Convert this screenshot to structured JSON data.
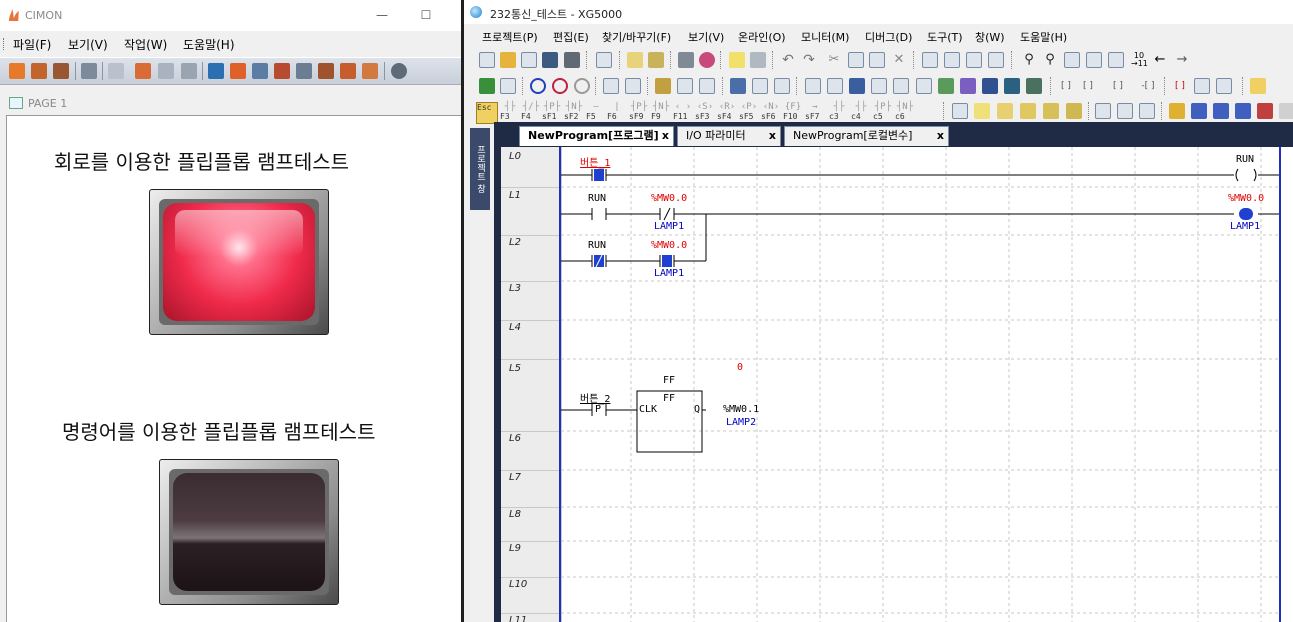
{
  "cimon": {
    "title": "CIMON",
    "menu": [
      "파일(F)",
      "보기(V)",
      "작업(W)",
      "도움말(H)"
    ],
    "page_tab": "PAGE 1",
    "lamp1_title": "회로를 이용한 플립플롭 램프테스트",
    "lamp2_title": "명령어를 이용한 플립플롭 램프테스트",
    "lamp1_state": "on",
    "lamp2_state": "off"
  },
  "xg": {
    "title": "232통신_테스트 - XG5000",
    "menu": [
      "프로젝트(P)",
      "편집(E)",
      "찾기/바꾸기(F)",
      "보기(V)",
      "온라인(O)",
      "모니터(M)",
      "디버그(D)",
      "도구(T)",
      "창(W)",
      "도움말(H)"
    ],
    "fkeys": [
      {
        "sym": "",
        "lbl": "Esc"
      },
      {
        "sym": "┤├",
        "lbl": "F3"
      },
      {
        "sym": "┤/├",
        "lbl": "F4"
      },
      {
        "sym": "┤P├",
        "lbl": "sF1"
      },
      {
        "sym": "┤N├",
        "lbl": "sF2"
      },
      {
        "sym": "—",
        "lbl": "F5"
      },
      {
        "sym": "|",
        "lbl": "F6"
      },
      {
        "sym": "┤P├",
        "lbl": "sF9"
      },
      {
        "sym": "┤N├",
        "lbl": "F9"
      },
      {
        "sym": "‹ ›",
        "lbl": "F11"
      },
      {
        "sym": "‹S›",
        "lbl": "sF3"
      },
      {
        "sym": "‹R›",
        "lbl": "sF4"
      },
      {
        "sym": "‹P›",
        "lbl": "sF5"
      },
      {
        "sym": "‹N›",
        "lbl": "sF6"
      },
      {
        "sym": "{F}",
        "lbl": "F10"
      },
      {
        "sym": "→",
        "lbl": "sF7"
      },
      {
        "sym": "┤├",
        "lbl": "c3"
      },
      {
        "sym": "┤├",
        "lbl": "c4"
      },
      {
        "sym": "┤P├",
        "lbl": "c5"
      },
      {
        "sym": "┤N├",
        "lbl": "c6"
      }
    ],
    "side_tab": "프로젝트 창",
    "tabs": [
      "NewProgram[프로그램]",
      "I/O 파라미터",
      "NewProgram[로컬변수]"
    ],
    "tab_close": "x",
    "rungs": [
      "L0",
      "L1",
      "L2",
      "L3",
      "L4",
      "L5",
      "L6",
      "L7",
      "L8",
      "L9",
      "L10",
      "L11"
    ],
    "ladder": {
      "l0_contact_name": "버튼_1",
      "l0_coil_name": "RUN",
      "l1_contact_name": "RUN",
      "l1_nc_name": "%MW0.0",
      "l1_nc_comment": "LAMP1",
      "l1_coil_name": "%MW0.0",
      "l1_coil_comment": "LAMP1",
      "l2_nc_name": "RUN",
      "l2_no_name": "%MW0.0",
      "l2_no_comment": "LAMP1",
      "l5_value": "0",
      "l5_contact_name": "버튼_2",
      "l5_contact_type": "P",
      "ff_title": "FF",
      "ff_inner": "FF",
      "ff_clk": "CLK",
      "ff_q": "Q",
      "ff_out_name": "%MW0.1",
      "ff_out_comment": "LAMP2"
    }
  }
}
